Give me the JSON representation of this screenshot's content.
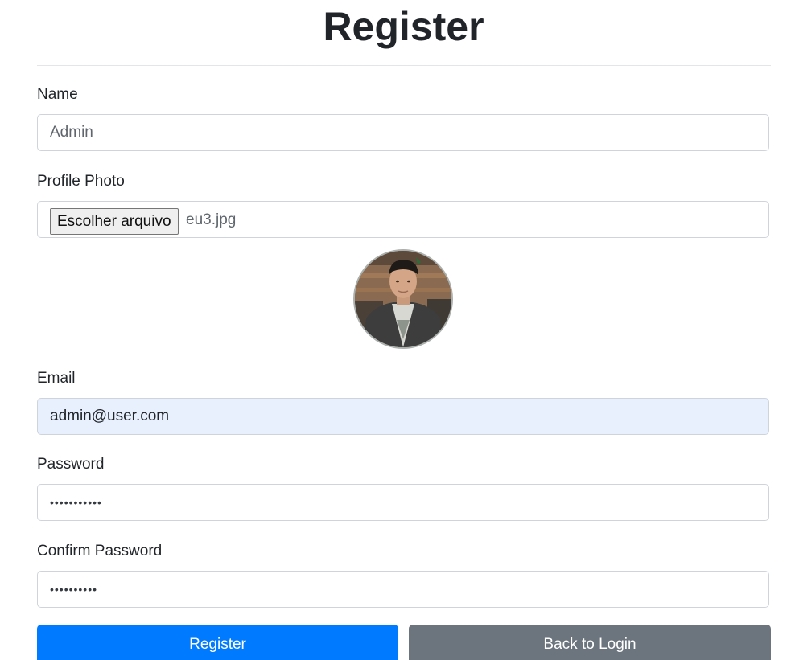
{
  "form": {
    "title": "Register",
    "name": {
      "label": "Name",
      "placeholder": "Admin"
    },
    "photo": {
      "label": "Profile Photo",
      "button_label": "Escolher arquivo",
      "file_name": "eu3.jpg"
    },
    "email": {
      "label": "Email",
      "value": "admin@user.com"
    },
    "password": {
      "label": "Password",
      "masked": "•••••••••••"
    },
    "confirm_password": {
      "label": "Confirm Password",
      "masked": "••••••••••"
    },
    "buttons": {
      "register": "Register",
      "back_to_login": "Back to Login"
    }
  },
  "colors": {
    "primary": "#007bff",
    "secondary": "#6c757d",
    "autofill_background": "#e8f0fe"
  }
}
